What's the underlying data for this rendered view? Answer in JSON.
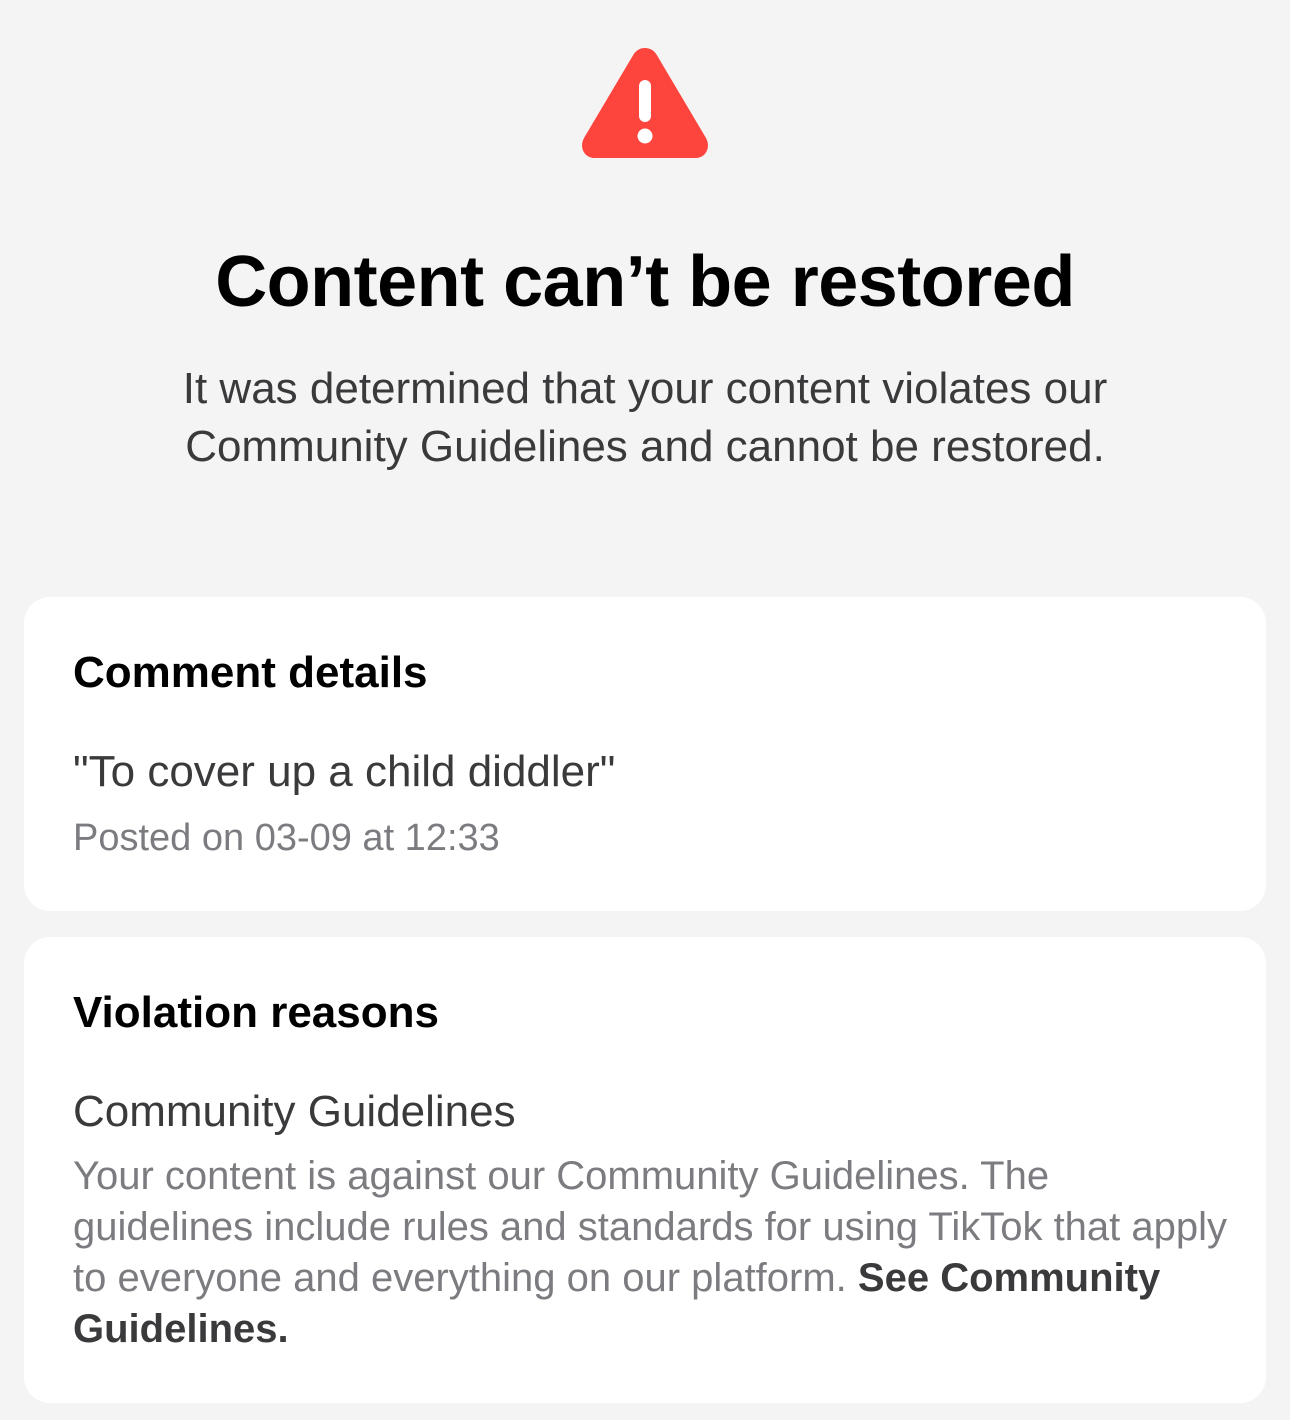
{
  "header": {
    "icon": "warning-triangle-icon",
    "icon_color": "#fe453d",
    "title": "Content can’t be restored",
    "subtitle": "It was determined that your content violates our Community Guidelines and cannot be restored."
  },
  "comment_card": {
    "title": "Comment details",
    "comment": "\"To cover up a child diddler\"",
    "posted": "Posted on 03-09 at 12:33"
  },
  "violation_card": {
    "title": "Violation reasons",
    "reason_name": "Community Guidelines",
    "reason_description": "Your content is against our Community Guidelines. The guidelines include rules and standards for using TikTok that apply to everyone and everything on our platform.",
    "link_label": "See Community Guidelines."
  }
}
